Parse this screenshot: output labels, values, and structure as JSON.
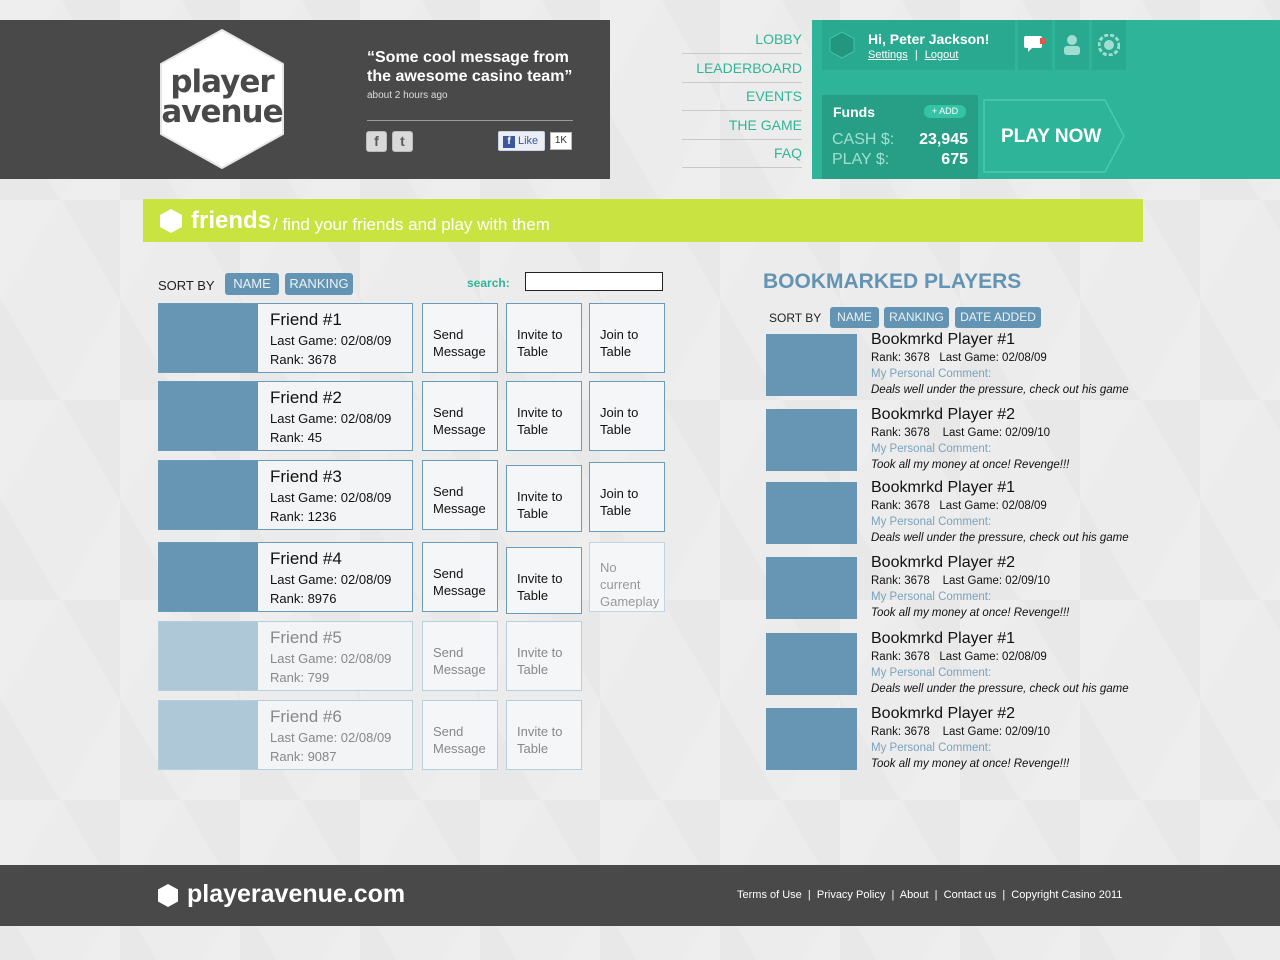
{
  "header": {
    "logo_line1": "player",
    "logo_line2": "avenue",
    "quote": "“Some cool message from the awesome casino team”",
    "quote_time": "about 2 hours ago",
    "facebook_like": "Like",
    "like_count": "1K"
  },
  "nav": [
    "LOBBY",
    "LEADERBOARD",
    "EVENTS",
    "THE GAME",
    "FAQ"
  ],
  "user": {
    "greeting": "Hi, Peter Jackson!",
    "settings": "Settings",
    "separator": "|",
    "logout": "Logout",
    "funds_label": "Funds",
    "add_label": "+ ADD",
    "cash_label": "CASH $:",
    "cash_value": "23,945",
    "play_label": "PLAY $:",
    "play_value": "675",
    "play_now": "PLAY NOW"
  },
  "friends_bar": {
    "title": "friends",
    "subtitle": "/ find your friends and play with them"
  },
  "friends_sort": {
    "label": "SORT BY",
    "options": [
      "NAME",
      "RANKING"
    ],
    "search_label": "search:",
    "search_value": ""
  },
  "friends": [
    {
      "name": "Friend #1",
      "last_game": "Last Game: 02/08/09",
      "rank": "Rank: 3678",
      "send": "Send Message",
      "invite": "Invite to Table",
      "join": "Join to Table"
    },
    {
      "name": "Friend #2",
      "last_game": "Last Game: 02/08/09",
      "rank": "Rank: 45",
      "send": "Send Message",
      "invite": "Invite to Table",
      "join": "Join to Table"
    },
    {
      "name": "Friend #3",
      "last_game": "Last Game: 02/08/09",
      "rank": "Rank: 1236",
      "send": "Send Message",
      "invite": "Invite to Table",
      "join": "Join to Table"
    },
    {
      "name": "Friend #4",
      "last_game": "Last Game: 02/08/09",
      "rank": "Rank: 8976",
      "send": "Send Message",
      "invite": "Invite to Table",
      "join": "No current Gameplay"
    },
    {
      "name": "Friend #5",
      "last_game": "Last Game: 02/08/09",
      "rank": "Rank: 799",
      "send": "Send Message",
      "invite": "Invite to Table",
      "join": ""
    },
    {
      "name": "Friend #6",
      "last_game": "Last Game: 02/08/09",
      "rank": "Rank: 9087",
      "send": "Send Message",
      "invite": "Invite to Table",
      "join": ""
    }
  ],
  "bookmarks": {
    "title": "BOOKMARKED PLAYERS",
    "sort_label": "SORT BY",
    "sort_options": [
      "NAME",
      "RANKING",
      "DATE ADDED"
    ],
    "comment_label": "My Personal Comment:",
    "items": [
      {
        "name": "Bookmrkd Player #1",
        "meta": "Rank: 3678   Last Game: 02/08/09",
        "comment": "Deals well under the pressure, check out his game"
      },
      {
        "name": "Bookmrkd Player #2",
        "meta": "Rank: 3678    Last Game: 02/09/10",
        "comment": "Took all my money at once! Revenge!!!"
      },
      {
        "name": "Bookmrkd Player #1",
        "meta": "Rank: 3678   Last Game: 02/08/09",
        "comment": "Deals well under the pressure, check out his game"
      },
      {
        "name": "Bookmrkd Player #2",
        "meta": "Rank: 3678    Last Game: 02/09/10",
        "comment": "Took all my money at once! Revenge!!!"
      },
      {
        "name": "Bookmrkd Player #1",
        "meta": "Rank: 3678   Last Game: 02/08/09",
        "comment": "Deals well under the pressure, check out his game"
      },
      {
        "name": "Bookmrkd Player #2",
        "meta": "Rank: 3678    Last Game: 02/09/10",
        "comment": "Took all my money at once! Revenge!!!"
      }
    ]
  },
  "footer": {
    "site": "playeravenue.com",
    "links": "Terms of Use  |  Privacy Policy  |  About  |  Contact us  |  Copyright Casino 2011"
  },
  "colors": {
    "teal": "#2db499",
    "lime": "#c9e441",
    "steel_blue": "#6394b3",
    "dark": "#4a4949"
  },
  "icons": [
    "hexagon-logo-icon",
    "facebook-icon",
    "twitter-icon",
    "chat-icon",
    "user-icon",
    "chip-icon"
  ]
}
